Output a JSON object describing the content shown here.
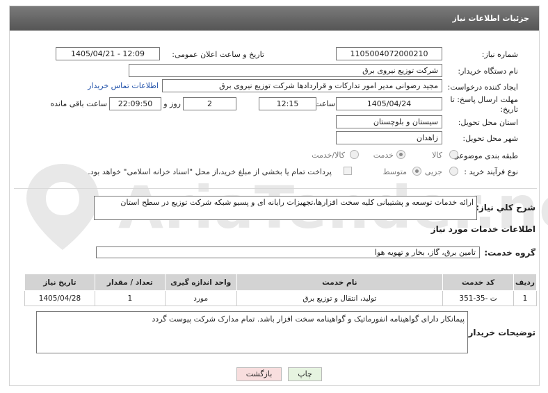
{
  "header": {
    "title": "جزئیات اطلاعات نیاز"
  },
  "form": {
    "need_number_label": "شماره نیاز:",
    "need_number": "1105004072000210",
    "announce_label": "تاریخ و ساعت اعلان عمومی:",
    "announce_value": "1405/04/21 - 12:09",
    "buyer_label": "نام دستگاه خریدار:",
    "buyer_value": "شرکت توزیع نیروی برق",
    "creator_label": "ایجاد کننده درخواست:",
    "creator_value": "مجید  رضوانی مدیر امور تدارکات و قراردادها شرکت توزیع نیروی برق",
    "contact_link": "اطلاعات تماس خریدار",
    "deadline_label": "مهلت ارسال پاسخ: تا تاریخ:",
    "deadline_date": "1405/04/24",
    "time_label": "ساعت",
    "deadline_time": "12:15",
    "days_value": "2",
    "days_label": "روز و",
    "remaining_value": "22:09:50",
    "remaining_label": "ساعت باقی مانده",
    "province_label": "استان محل تحویل:",
    "province_value": "سیستان و بلوچستان",
    "city_label": "شهر محل تحویل:",
    "city_value": "زاهدان",
    "category_label": "طبقه بندی موضوعی:",
    "category_options": [
      "کالا",
      "خدمت",
      "کالا/خدمت"
    ],
    "process_label": "نوع فرآیند خرید :",
    "process_options": [
      "جزیی",
      "متوسط"
    ],
    "payment_note": "پرداخت تمام یا بخشی از مبلغ خرید،از محل \"اسناد خزانه اسلامی\" خواهد بود."
  },
  "summary": {
    "label": "شرح كلي نياز:",
    "text": "ارائه خدمات توسعه و پشتیبانی کلیه سخت افزارها،تجهیزات رایانه ای و پسیو شبکه شرکت توزیع در سطح استان"
  },
  "services": {
    "section_title": "اطلاعات خدمات مورد نياز",
    "group_label": "گروه خدمت:",
    "group_value": "تامین برق، گاز، بخار و تهویه هوا",
    "columns": [
      "ردیف",
      "کد خدمت",
      "نام خدمت",
      "واحد اندازه گیری",
      "تعداد / مقدار",
      "تاریخ نیاز"
    ],
    "rows": [
      {
        "row": "1",
        "code": "ت -35-351",
        "name": "تولید، انتقال و توزیع برق",
        "unit": "مورد",
        "qty": "1",
        "date": "1405/04/28"
      }
    ]
  },
  "buyer_notes": {
    "label": "توضیحات خریدار:",
    "text": "پیمانکار دارای گواهینامه انفورماتیک و گواهینامه سخت افزار باشد. تمام مدارک شرکت پیوست گردد"
  },
  "buttons": {
    "print": "چاپ",
    "back": "بازگشت"
  },
  "watermark": {
    "text": "AriaTender.neT"
  },
  "colors": {
    "header_bg": "#666666",
    "link": "#1e4fa8",
    "back_button": "#f8dede",
    "print_button": "#e6f4e0"
  }
}
